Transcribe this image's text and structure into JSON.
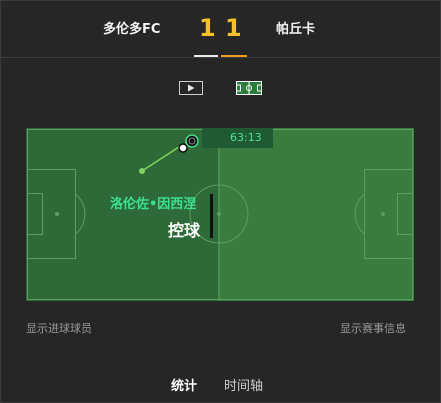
{
  "match": {
    "home_team": "多伦多FC",
    "away_team": "帕丘卡",
    "home_score": "1",
    "away_score": "1"
  },
  "view_toggle": {
    "video_icon": "play-icon",
    "field_icon": "pitch-icon"
  },
  "event": {
    "time": "63:13",
    "player": "洛伦佐•因西涅",
    "action": "控球"
  },
  "links": {
    "show_scorers": "显示进球球员",
    "show_match_info": "显示赛事信息"
  },
  "tabs": [
    {
      "label": "统计",
      "active": true
    },
    {
      "label": "时间轴",
      "active": false
    }
  ],
  "colors": {
    "score": "#f6c026",
    "active_underline": "#f39a1d",
    "pitch": "#3a7c3e",
    "possession_half": "#2d6a37",
    "accent_green": "#3ee08e"
  }
}
